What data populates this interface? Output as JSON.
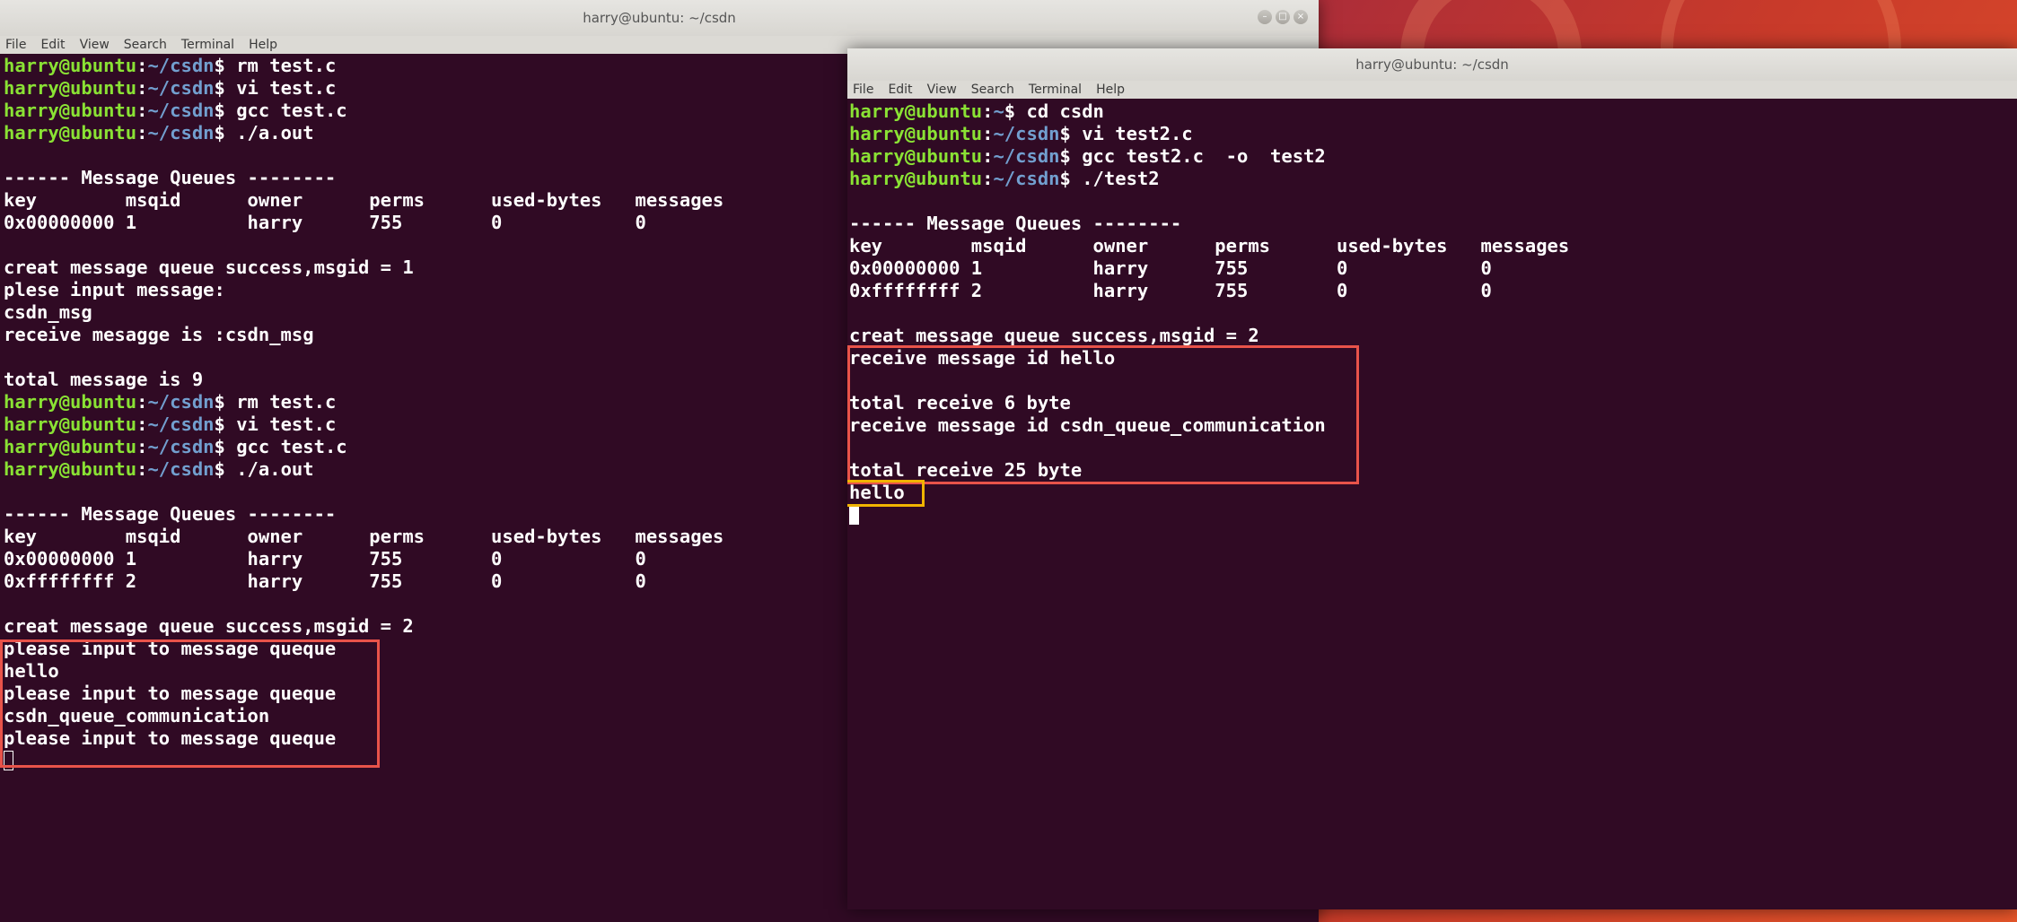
{
  "colors": {
    "terminal_bg": "#300a24",
    "user_green": "#8ae234",
    "path_blue": "#729fcf",
    "annotation_red": "#e8534a",
    "annotation_orange": "#f0b400"
  },
  "menu": [
    "File",
    "Edit",
    "View",
    "Search",
    "Terminal",
    "Help"
  ],
  "left_window": {
    "title": "harry@ubuntu: ~/csdn",
    "lines": [
      {
        "type": "prompt",
        "user": "harry@ubuntu",
        "path": "~/csdn",
        "cmd": " rm test.c"
      },
      {
        "type": "prompt",
        "user": "harry@ubuntu",
        "path": "~/csdn",
        "cmd": " vi test.c"
      },
      {
        "type": "prompt",
        "user": "harry@ubuntu",
        "path": "~/csdn",
        "cmd": " gcc test.c"
      },
      {
        "type": "prompt",
        "user": "harry@ubuntu",
        "path": "~/csdn",
        "cmd": " ./a.out"
      },
      {
        "type": "text",
        "text": ""
      },
      {
        "type": "text",
        "text": "------ Message Queues --------"
      },
      {
        "type": "text",
        "text": "key        msqid      owner      perms      used-bytes   messages"
      },
      {
        "type": "text",
        "text": "0x00000000 1          harry      755        0            0"
      },
      {
        "type": "text",
        "text": ""
      },
      {
        "type": "text",
        "text": "creat message queue success,msgid = 1"
      },
      {
        "type": "text",
        "text": "plese input message:"
      },
      {
        "type": "text",
        "text": "csdn_msg"
      },
      {
        "type": "text",
        "text": "receive mesagge is :csdn_msg"
      },
      {
        "type": "text",
        "text": ""
      },
      {
        "type": "text",
        "text": "total message is 9"
      },
      {
        "type": "prompt",
        "user": "harry@ubuntu",
        "path": "~/csdn",
        "cmd": " rm test.c"
      },
      {
        "type": "prompt",
        "user": "harry@ubuntu",
        "path": "~/csdn",
        "cmd": " vi test.c"
      },
      {
        "type": "prompt",
        "user": "harry@ubuntu",
        "path": "~/csdn",
        "cmd": " gcc test.c"
      },
      {
        "type": "prompt",
        "user": "harry@ubuntu",
        "path": "~/csdn",
        "cmd": " ./a.out"
      },
      {
        "type": "text",
        "text": ""
      },
      {
        "type": "text",
        "text": "------ Message Queues --------"
      },
      {
        "type": "text",
        "text": "key        msqid      owner      perms      used-bytes   messages"
      },
      {
        "type": "text",
        "text": "0x00000000 1          harry      755        0            0"
      },
      {
        "type": "text",
        "text": "0xffffffff 2          harry      755        0            0"
      },
      {
        "type": "text",
        "text": ""
      },
      {
        "type": "text",
        "text": "creat message queue success,msgid = 2"
      },
      {
        "type": "text",
        "text": "please input to message queque"
      },
      {
        "type": "text",
        "text": "hello"
      },
      {
        "type": "text",
        "text": "please input to message queque"
      },
      {
        "type": "text",
        "text": "csdn_queue_communication"
      },
      {
        "type": "text",
        "text": "please input to message queque"
      },
      {
        "type": "cursor",
        "style": "hollow"
      }
    ]
  },
  "right_window": {
    "title": "harry@ubuntu: ~/csdn",
    "lines": [
      {
        "type": "prompt",
        "user": "harry@ubuntu",
        "path": "~",
        "cmd": " cd csdn"
      },
      {
        "type": "prompt",
        "user": "harry@ubuntu",
        "path": "~/csdn",
        "cmd": " vi test2.c"
      },
      {
        "type": "prompt",
        "user": "harry@ubuntu",
        "path": "~/csdn",
        "cmd": " gcc test2.c  -o  test2"
      },
      {
        "type": "prompt",
        "user": "harry@ubuntu",
        "path": "~/csdn",
        "cmd": " ./test2"
      },
      {
        "type": "text",
        "text": ""
      },
      {
        "type": "text",
        "text": "------ Message Queues --------"
      },
      {
        "type": "text",
        "text": "key        msqid      owner      perms      used-bytes   messages"
      },
      {
        "type": "text",
        "text": "0x00000000 1          harry      755        0            0"
      },
      {
        "type": "text",
        "text": "0xffffffff 2          harry      755        0            0"
      },
      {
        "type": "text",
        "text": ""
      },
      {
        "type": "text",
        "text": "creat message queue success,msgid = 2"
      },
      {
        "type": "text",
        "text": "receive message id hello"
      },
      {
        "type": "text",
        "text": ""
      },
      {
        "type": "text",
        "text": "total receive 6 byte"
      },
      {
        "type": "text",
        "text": "receive message id csdn_queue_communication"
      },
      {
        "type": "text",
        "text": ""
      },
      {
        "type": "text",
        "text": "total receive 25 byte"
      },
      {
        "type": "text",
        "text": "hello"
      },
      {
        "type": "cursor",
        "style": "solid"
      }
    ]
  },
  "window_controls": {
    "minimize": "–",
    "maximize": "□",
    "close": "×"
  }
}
